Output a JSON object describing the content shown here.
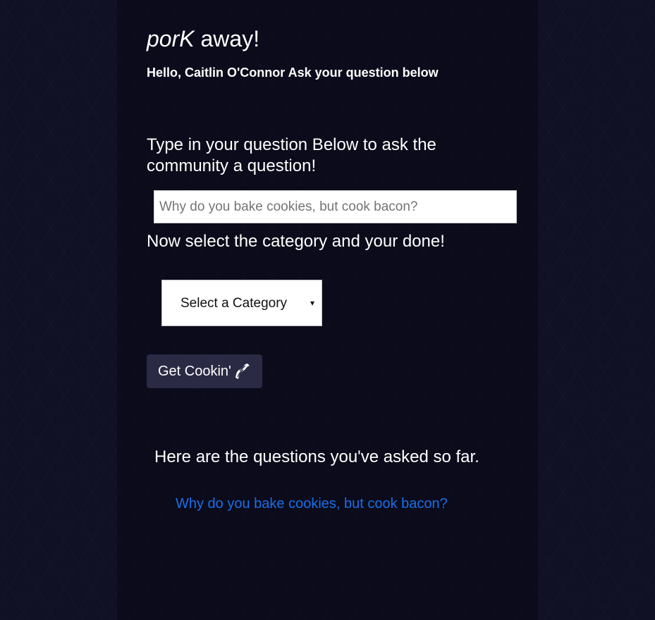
{
  "brand": {
    "emphasis": "porK",
    "rest": " away!"
  },
  "greeting": "Hello, Caitlin O'Connor Ask your question below",
  "ask_form": {
    "prompt": "Type in your question Below to ask the community a question!",
    "question_placeholder": "Why do you bake cookies, but cook bacon?",
    "question_value": "",
    "category_prompt": "Now select the category and your done!",
    "category_selected": "Select a Category",
    "submit_label": "Get Cookin'",
    "submit_icon": "bacon-icon"
  },
  "asked": {
    "heading": "Here are the questions you've asked so far.",
    "questions": [
      "Why do you bake cookies, but cook bacon?"
    ]
  },
  "colors": {
    "background": "#111126",
    "button": "#2a2a44",
    "link": "#1a6fe8"
  }
}
